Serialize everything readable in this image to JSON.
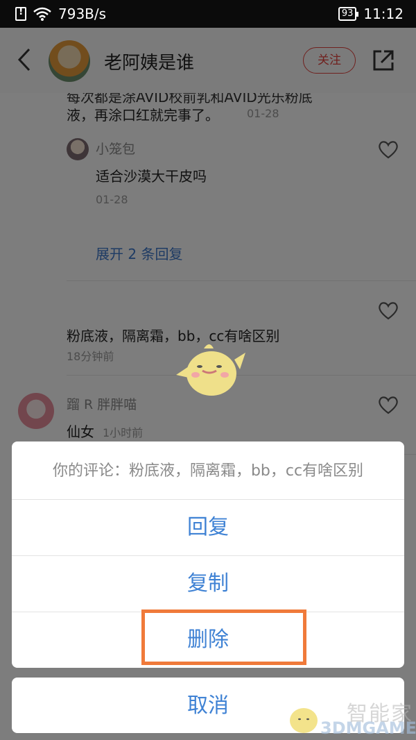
{
  "status_bar": {
    "speed": "793B/s",
    "battery": "93",
    "time": "11:12"
  },
  "header": {
    "title": "老阿姨是谁",
    "follow_label": "关注"
  },
  "comments": {
    "cut_text": "每次都是涂AVID校前乳和AVID光乐粉底",
    "first_text": "液，再涂口红就完事了。",
    "first_time": "01-28",
    "reply_name": "小笼包",
    "reply_text": "适合沙漠大干皮吗",
    "reply_time": "01-28",
    "expand_label": "展开 2 条回复",
    "second_text": "粉底液，隔离霜，bb，cc有啥区别",
    "second_time": "18分钟前",
    "third_name": "蹓 R 胖胖喵",
    "third_text": "仙女",
    "third_time": "1小时前"
  },
  "action_sheet": {
    "title": "你的评论：粉底液，隔离霜，bb，cc有啥区别",
    "reply": "回复",
    "copy": "复制",
    "delete": "删除",
    "cancel": "取消"
  },
  "watermark": {
    "cn": "智能家",
    "brand": "3DMGAME"
  },
  "colors": {
    "accent_blue": "#3f82d4",
    "follow_red": "#e0413c",
    "highlight_orange": "#f07a3a"
  }
}
